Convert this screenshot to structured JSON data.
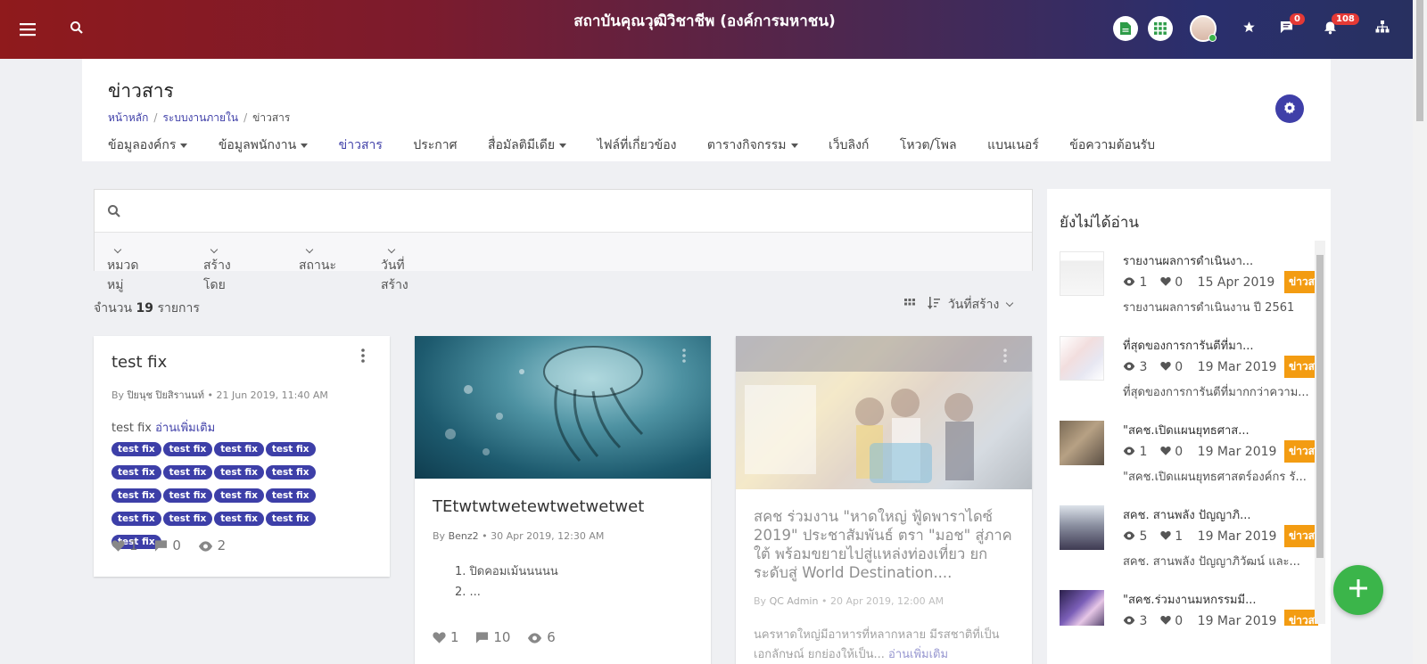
{
  "topbar": {
    "title": "สถาบันคุณวุฒิวิชาชีพ (องค์การมหาชน)",
    "chat_badge": "0",
    "notify_badge": "108"
  },
  "header": {
    "title": "ข่าวสาร",
    "breadcrumb": [
      "หน้าหลัก",
      "ระบบงานภายใน",
      "ข่าวสาร"
    ],
    "menu": [
      {
        "label": "ข้อมูลองค์กร",
        "dropdown": true
      },
      {
        "label": "ข้อมูลพนักงาน",
        "dropdown": true
      },
      {
        "label": "ข่าวสาร",
        "active": true
      },
      {
        "label": "ประกาศ"
      },
      {
        "label": "สื่อมัลติมีเดีย",
        "dropdown": true
      },
      {
        "label": "ไฟล์ที่เกี่ยวข้อง"
      },
      {
        "label": "ตารางกิจกรรม",
        "dropdown": true
      },
      {
        "label": "เว็บลิงก์"
      },
      {
        "label": "โหวต/โพล"
      },
      {
        "label": "แบนเนอร์"
      },
      {
        "label": "ข้อความต้อนรับ"
      }
    ]
  },
  "search": {
    "placeholder": "",
    "filters": [
      "หมวดหมู่",
      "สร้างโดย",
      "สถานะ",
      "วันที่สร้าง"
    ]
  },
  "list": {
    "count_prefix": "จำนวน",
    "count": "19",
    "count_suffix": "รายการ",
    "sort_label": "วันที่สร้าง"
  },
  "cards": [
    {
      "title": "test fix",
      "by": "By",
      "author": "ปิยนุช ปิยสิรานนท์",
      "date": "• 21 Jun 2019, 11:40 AM",
      "excerpt": "test fix",
      "read_more": "อ่านเพิ่มเติม",
      "tags": [
        "test fix",
        "test fix",
        "test fix",
        "test fix",
        "test fix",
        "test fix",
        "test fix",
        "test fix",
        "test fix",
        "test fix",
        "test fix",
        "test fix",
        "test fix",
        "test fix",
        "test fix",
        "test fix",
        "test fix"
      ],
      "likes": "1",
      "comments": "0",
      "views": "2"
    },
    {
      "title": "TEtwtwtwetewtwetwetwet",
      "by": "By",
      "author": "Benz2",
      "date": "• 30 Apr 2019, 12:30 AM",
      "list_items": [
        "1. ปิดคอมเม้นนนนน",
        "2. ..."
      ],
      "likes": "1",
      "comments": "10",
      "views": "6"
    },
    {
      "title": "สคช ร่วมงาน \"หาดใหญ่ ฟู้ดพาราไดซ์ 2019\" ประชาสัมพันธ์ ตรา \"มอช\" สู่ภาคใต้ พร้อมขยายไปสู่แหล่งท่องเที่ยว ยกระดับสู่ World Destination....",
      "by": "By",
      "author": "QC Admin",
      "date": "• 20 Apr 2019, 12:00 AM",
      "excerpt": "นครหาดใหญ่มีอาหารที่หลากหลาย มีรสชาติที่เป็นเอกลักษณ์ ยกย่องให้เป็น...",
      "read_more": "อ่านเพิ่มเติม"
    }
  ],
  "sidebar": {
    "title": "ยังไม่ได้อ่าน",
    "items": [
      {
        "title": "รายงานผลการดำเนินงา...",
        "views": "1",
        "likes": "0",
        "date": "15 Apr 2019",
        "tag": "ข่าวสาร",
        "desc": "รายงานผลการดำเนินงาน ปี 2561"
      },
      {
        "title": "ที่สุดของการการันตีที่มา...",
        "views": "3",
        "likes": "0",
        "date": "19 Mar 2019",
        "tag": "ข่าวสาร",
        "desc": "ที่สุดของการการันตีที่มากกว่าความ..."
      },
      {
        "title": "\"สคช.เปิดแผนยุทธศาส...",
        "views": "1",
        "likes": "0",
        "date": "19 Mar 2019",
        "tag": "ข่าวสาร",
        "desc": "\"สคช.เปิดแผนยุทธศาสตร์องค์กร รั..."
      },
      {
        "title": "สคช. สานพลัง ปัญญาภิ...",
        "views": "5",
        "likes": "1",
        "date": "19 Mar 2019",
        "tag": "ข่าวสาร",
        "desc": "สคช. สานพลัง ปัญญาภิวัฒน์ และ..."
      },
      {
        "title": "\"สคช.ร่วมงานมหกรรมมี...",
        "views": "3",
        "likes": "0",
        "date": "19 Mar 2019",
        "tag": "ข่าวสาร",
        "desc": ""
      }
    ]
  },
  "colors": {
    "primary": "#3f3fa8",
    "tag_bg": "#3d3fa8",
    "badge": "#e53935",
    "orange_tag": "#f39c12",
    "fab": "#3bb54a"
  },
  "icons": [
    "menu-icon",
    "search-icon",
    "document-icon",
    "apps-grid-icon",
    "star-icon",
    "chat-icon",
    "bell-icon",
    "sitemap-icon",
    "gear-icon",
    "grid-view-icon",
    "sort-icon",
    "heart-icon",
    "comment-icon",
    "eye-icon",
    "kebab-icon",
    "plus-icon"
  ]
}
